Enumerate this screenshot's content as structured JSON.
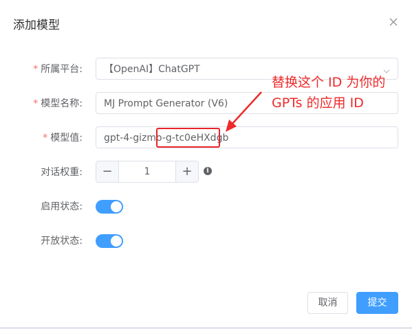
{
  "dialog": {
    "title": "添加模型",
    "close_icon": "close-icon"
  },
  "form": {
    "platform": {
      "label": "所属平台:",
      "required": "*",
      "value": "【OpenAI】ChatGPT"
    },
    "model_name": {
      "label": "模型名称:",
      "required": "*",
      "value": "MJ Prompt Generator (V6)"
    },
    "model_value": {
      "label": "模型值:",
      "required": "*",
      "value_prefix": "gpt-4-gizmo-",
      "value_highlight": "g-tc0eHXdgb"
    },
    "weight": {
      "label": "对话权重:",
      "value": "1",
      "minus": "−",
      "plus": "+",
      "info": "i"
    },
    "enabled": {
      "label": "启用状态:",
      "on": true
    },
    "public": {
      "label": "开放状态:",
      "on": true
    }
  },
  "annotation": {
    "line1": "替换这个 ID  为你的",
    "line2": "GPTs 的应用 ID",
    "color": "#ee2a2a"
  },
  "buttons": {
    "cancel": "取消",
    "submit": "提交"
  },
  "colors": {
    "primary": "#409eff",
    "required": "#f56c6c",
    "highlight": "#e8242a"
  }
}
